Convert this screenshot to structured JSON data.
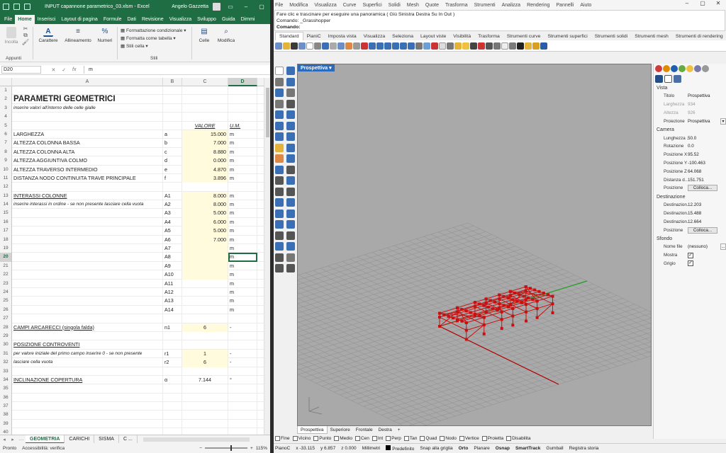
{
  "excel": {
    "title": "INPUT capannone parametrico_03.xlsm  -  Excel",
    "user": "Angelo Gazzetta",
    "tabs": [
      "File",
      "Home",
      "Inserisci",
      "Layout di pagina",
      "Formule",
      "Dati",
      "Revisione",
      "Visualizza",
      "Sviluppo",
      "Guida",
      "Dimmi"
    ],
    "ribbon": {
      "paste": "Incolla",
      "font": "Carattere",
      "align": "Allineamento",
      "number": "Numeri",
      "cond_format": "Formattazione condizionale",
      "format_table": "Formatta come tabella",
      "cell_styles": "Stili cella",
      "cells": "Celle",
      "edit": "Modifica",
      "clipboard_group": "Appunti",
      "styles_group": "Stili"
    },
    "name_box": "D20",
    "formula_value": "m",
    "columns": [
      "A",
      "B",
      "C",
      "D"
    ],
    "rows": [
      {
        "n": "1",
        "a": "",
        "b": "",
        "c": "",
        "d": ""
      },
      {
        "n": "2",
        "a": "PARAMETRI GEOMETRICI",
        "b": "",
        "c": "",
        "d": "",
        "style": "title"
      },
      {
        "n": "3",
        "a": "inserire valori all'interno delle celle gialle",
        "b": "",
        "c": "",
        "d": "",
        "style": "italic"
      },
      {
        "n": "4",
        "a": "",
        "b": "",
        "c": "",
        "d": ""
      },
      {
        "n": "5",
        "a": "",
        "b": "",
        "c": "VALORE",
        "d": "U.M.",
        "style": "header"
      },
      {
        "n": "6",
        "a": "LARGHEZZA",
        "b": "a",
        "c": "15.000",
        "d": "m",
        "yellow": true
      },
      {
        "n": "7",
        "a": "ALTEZZA COLONNA BASSA",
        "b": "b",
        "c": "7.000",
        "d": "m",
        "yellow": true
      },
      {
        "n": "8",
        "a": "ALTEZZA COLONNA ALTA",
        "b": "c",
        "c": "8.880",
        "d": "m",
        "yellow": true
      },
      {
        "n": "9",
        "a": "ALTEZZA AGGIUNTIVA COLMO",
        "b": "d",
        "c": "0.000",
        "d": "m",
        "yellow": true
      },
      {
        "n": "10",
        "a": "ALTEZZA TRAVERSO INTERMEDIO",
        "b": "e",
        "c": "4.870",
        "d": "m",
        "yellow": true
      },
      {
        "n": "11",
        "a": "DISTANZA NODO CONTINUITA TRAVE PRINCIPALE",
        "b": "f",
        "c": "3.896",
        "d": "m",
        "yellow": true
      },
      {
        "n": "12",
        "a": "",
        "b": "",
        "c": "",
        "d": ""
      },
      {
        "n": "13",
        "a": "INTERASSI COLONNE",
        "b": "A1",
        "c": "8.000",
        "d": "m",
        "yellow": true,
        "style": "underline"
      },
      {
        "n": "14",
        "a": "inserire interassi in ordine - se non presente lasciare cella vuota",
        "b": "A2",
        "c": "8.000",
        "d": "m",
        "yellow": true,
        "style": "italic"
      },
      {
        "n": "15",
        "a": "",
        "b": "A3",
        "c": "5.000",
        "d": "m",
        "yellow": true
      },
      {
        "n": "16",
        "a": "",
        "b": "A4",
        "c": "6.000",
        "d": "m",
        "yellow": true
      },
      {
        "n": "17",
        "a": "",
        "b": "A5",
        "c": "5.000",
        "d": "m",
        "yellow": true
      },
      {
        "n": "18",
        "a": "",
        "b": "A6",
        "c": "7.000",
        "d": "m",
        "yellow": true
      },
      {
        "n": "19",
        "a": "",
        "b": "A7",
        "c": "",
        "d": "m",
        "yellow": true
      },
      {
        "n": "20",
        "a": "",
        "b": "A8",
        "c": "",
        "d": "m",
        "yellow": true,
        "selected": true
      },
      {
        "n": "21",
        "a": "",
        "b": "A9",
        "c": "",
        "d": "m",
        "yellow": true
      },
      {
        "n": "22",
        "a": "",
        "b": "A10",
        "c": "",
        "d": "m",
        "yellow": true
      },
      {
        "n": "23",
        "a": "",
        "b": "A11",
        "c": "",
        "d": "m"
      },
      {
        "n": "24",
        "a": "",
        "b": "A12",
        "c": "",
        "d": "m"
      },
      {
        "n": "25",
        "a": "",
        "b": "A13",
        "c": "",
        "d": "m"
      },
      {
        "n": "26",
        "a": "",
        "b": "A14",
        "c": "",
        "d": "m"
      },
      {
        "n": "27",
        "a": "",
        "b": "",
        "c": "",
        "d": ""
      },
      {
        "n": "28",
        "a": "CAMPI ARCARECCI (singola falda)",
        "b": "n1",
        "c": "6",
        "d": "-",
        "yellow": true,
        "center": true,
        "style": "underline"
      },
      {
        "n": "29",
        "a": "",
        "b": "",
        "c": "",
        "d": ""
      },
      {
        "n": "30",
        "a": "POSIZIONE CONTROVENTI",
        "b": "",
        "c": "",
        "d": "",
        "style": "underline"
      },
      {
        "n": "31",
        "a": "per valore iniziale del primo campo inserire 0 - se non presente",
        "b": "r1",
        "c": "1",
        "d": "-",
        "yellow": true,
        "center": true,
        "style": "italic"
      },
      {
        "n": "32",
        "a": "lasciare cella vuota",
        "b": "r2",
        "c": "6",
        "d": "-",
        "yellow": true,
        "center": true,
        "style": "italic"
      },
      {
        "n": "33",
        "a": "",
        "b": "",
        "c": "",
        "d": ""
      },
      {
        "n": "34",
        "a": "INCLINAZIONE COPERTURA",
        "b": "α",
        "c": "7.144",
        "d": "°",
        "center": true,
        "style": "underline"
      },
      {
        "n": "35",
        "a": "",
        "b": "",
        "c": "",
        "d": ""
      },
      {
        "n": "36",
        "a": "",
        "b": "",
        "c": "",
        "d": ""
      },
      {
        "n": "37",
        "a": "",
        "b": "",
        "c": "",
        "d": ""
      },
      {
        "n": "38",
        "a": "",
        "b": "",
        "c": "",
        "d": ""
      },
      {
        "n": "39",
        "a": "",
        "b": "",
        "c": "",
        "d": ""
      },
      {
        "n": "40",
        "a": "",
        "b": "",
        "c": "",
        "d": ""
      }
    ],
    "sheets": [
      "GEOMETRIA",
      "CARICHI",
      "SISMA",
      "C ..."
    ],
    "status": {
      "mode": "Pronto",
      "access": "Accessibilità: verifica",
      "zoom": "115%"
    }
  },
  "rhino": {
    "menu": [
      "File",
      "Modifica",
      "Visualizza",
      "Curve",
      "Superfici",
      "Solidi",
      "Mesh",
      "Quote",
      "Trasforma",
      "Strumenti",
      "Analizza",
      "Rendering",
      "Pannelli",
      "Aiuto"
    ],
    "cmd_history": [
      "Fare clic e trascinare per eseguire una panoramica ( Giù  Sinistra  Destra  Su  In  Out )",
      "Comando: _Grasshopper"
    ],
    "cmd_prompt": "Comando:",
    "toolbar_tabs": [
      "Standard",
      "PianiC",
      "Imposta vista",
      "Visualizza",
      "Seleziona",
      "Layout viste",
      "Visibilità",
      "Trasforma",
      "Strumenti curve",
      "Strumenti superfici",
      "Strumenti solidi",
      "Strumenti mesh",
      "Strumenti di rendering"
    ],
    "viewport_title": "Prospettiva",
    "viewport_tabs": [
      "Prospettiva",
      "Superiore",
      "Frontale",
      "Destra",
      "+"
    ],
    "panel": {
      "vista": "Vista",
      "camera": "Camera",
      "destinazione": "Destinazione",
      "sfondo": "Sfondo",
      "props_vista": [
        {
          "k": "Titolo",
          "v": "Prospettiva"
        },
        {
          "k": "Larghezza",
          "v": "934",
          "dim": true
        },
        {
          "k": "Altezza",
          "v": "926",
          "dim": true
        },
        {
          "k": "Proiezione",
          "v": "Prospettiva",
          "dd": true
        }
      ],
      "props_camera": [
        {
          "k": "Lunghezza ...",
          "v": "50.0"
        },
        {
          "k": "Rotazione",
          "v": "0.0"
        },
        {
          "k": "Posizione X",
          "v": "95.52"
        },
        {
          "k": "Posizione Y",
          "v": "-100.463"
        },
        {
          "k": "Posizione Z",
          "v": "64.068"
        },
        {
          "k": "Distanza d...",
          "v": "151.751"
        },
        {
          "k": "Posizione",
          "btn": "Colloca..."
        }
      ],
      "props_dest": [
        {
          "k": "Destinazion...",
          "v": "12.203"
        },
        {
          "k": "Destinazion...",
          "v": "15.488"
        },
        {
          "k": "Destinazion...",
          "v": "12.664"
        },
        {
          "k": "Posizione",
          "btn": "Colloca..."
        }
      ],
      "props_sfondo": [
        {
          "k": "Nome file",
          "v": "(nessuno)",
          "dots": "..."
        },
        {
          "k": "Mostra",
          "check": "✓"
        },
        {
          "k": "Grigio",
          "check": "✓"
        }
      ]
    },
    "osnaps": [
      "Fine",
      "Vicino",
      "Punto",
      "Medio",
      "Cen",
      "Int",
      "Perp",
      "Tan",
      "Quad",
      "Nodo",
      "Vertice",
      "Proietta",
      "Disabilita"
    ],
    "status": {
      "plane": "PianoC",
      "x": "x -33.115",
      "y": "y 6.857",
      "z": "z 0.000",
      "units": "Millimetri",
      "layer": "Predefinito",
      "snap": "Snap alla griglia",
      "ortho": "Orto",
      "planar": "Planare",
      "osnap": "Osnap",
      "smarttrack": "SmartTrack",
      "gumball": "Gumball",
      "history": "Registra storia"
    },
    "colors": {
      "structure": "#c81010",
      "grid": "#8f8f8f",
      "grid_bg": "#a9a9a9",
      "axis_x": "#b00000",
      "axis_y": "#1ea01e"
    }
  }
}
